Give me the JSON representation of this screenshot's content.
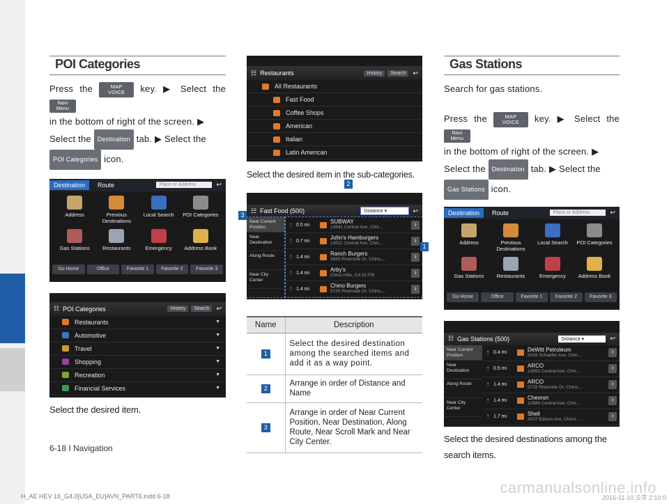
{
  "left": {
    "title": "POI Categories",
    "s1a": "Press the",
    "key_map": "MAP",
    "key_voice": "VOICE",
    "s1b": "key. ▶ Select the",
    "key_navi": "Navi",
    "key_menu": "Menu",
    "s2": "in the bottom of right of the screen. ▶",
    "s3a": "Select the",
    "pill_dest": "Destination",
    "s3b": "tab. ▶ Select the",
    "pill_poi": "POI Categories",
    "s4": "icon.",
    "caption": "Select the desired item.",
    "shot1": {
      "tab_dest": "Destination",
      "tab_route": "Route",
      "search_placeholder": "Place or Address",
      "tiles": [
        "Address",
        "Previous Destinations",
        "Local Search",
        "POI Categories",
        "Gas Stations",
        "Restaurants",
        "Emergency",
        "Address Book"
      ],
      "favs": [
        "Go Home",
        "Office",
        "Favorite 1",
        "Favorite 2",
        "Favorite 3"
      ]
    },
    "shot2": {
      "title": "POI Categories",
      "btn_history": "History",
      "btn_search": "Search",
      "items": [
        "Restaurants",
        "Automotive",
        "Travel",
        "Shopping",
        "Recreation",
        "Financial Services"
      ],
      "colors": [
        "#e07a2b",
        "#3a78c2",
        "#c89b3a",
        "#9a3fa0",
        "#7da23a",
        "#3f9a4a"
      ]
    }
  },
  "middle": {
    "shot3": {
      "title": "Restaurants",
      "btn_history": "History",
      "btn_search": "Search",
      "items": [
        "All Restaurants",
        "Fast Food",
        "Coffee Shops",
        "American",
        "Italian",
        "Latin American"
      ]
    },
    "caption": "Select the desired item in the sub-categories.",
    "shot4": {
      "title": "Fast Food (500)",
      "sort": "Distance",
      "side": [
        "Near Current Position",
        "Near Destination",
        "Along Route",
        "Near City Center"
      ],
      "rows": [
        {
          "dist": "0.5 mi",
          "name": "SUBWAY",
          "addr": "13641 Central Ave, Chin..."
        },
        {
          "dist": "0.7 mi",
          "name": "John's Hamburgers",
          "addr": "13511 Central Ave, Chin..."
        },
        {
          "dist": "1.4 mi",
          "name": "Ranch Burgers",
          "addr": "5685 Riverside Dr, Chino,..."
        },
        {
          "dist": "1.4 mi",
          "name": "Arby's",
          "addr": "Chino Hills, CA 91709"
        },
        {
          "dist": "1.4 mi",
          "name": "Chino Burgers",
          "addr": "5725 Riverside Dr, Chino,..."
        }
      ]
    },
    "markers": [
      "1",
      "2",
      "3"
    ],
    "table": {
      "col_name": "Name",
      "col_desc": "Description",
      "rows": [
        {
          "num": "1",
          "desc": "Select the desired destination among the searched items and add it as a way point."
        },
        {
          "num": "2",
          "desc": "Arrange in order of Distance and Name"
        },
        {
          "num": "3",
          "desc": "Arrange in order of Near Current Position, Near Destination, Along Route, Near Scroll Mark and Near City Center."
        }
      ]
    }
  },
  "right": {
    "title": "Gas Stations",
    "intro": "Search for gas stations.",
    "s1a": "Press the",
    "s1b": "key. ▶ Select the",
    "s2": "in the bottom of right of the screen. ▶",
    "s3a": "Select the",
    "pill_dest": "Destination",
    "s3b": "tab. ▶ Select the",
    "pill_gas": "Gas Stations",
    "s4": "icon.",
    "shot6": {
      "title": "Gas Stations (500)",
      "sort": "Distance",
      "rows": [
        {
          "dist": "0.4 mi",
          "name": "DeWitt Petroleum",
          "addr": "5415 Schaefer Ave, Chin..."
        },
        {
          "dist": "0.5 mi",
          "name": "ARCO",
          "addr": "13691 Central Ave, Chin..."
        },
        {
          "dist": "1.4 mi",
          "name": "ARCO",
          "addr": "5715 Riverside Dr, Chino,..."
        },
        {
          "dist": "1.4 mi",
          "name": "Chevron",
          "addr": "12886 Central Ave, Chin..."
        },
        {
          "dist": "1.7 mi",
          "name": "Shell",
          "addr": "4107 Edison Ave, Chino, ..."
        }
      ]
    },
    "caption": "Select the desired destinations among the search items."
  },
  "footer": {
    "page": "6-18 I Navigation",
    "file": "H_AE HEV 16_G4.0[USA_EU]AVN_PART6.indd   6-18",
    "date": "2016-11-10   오후 2:10:0",
    "watermark": "carmanualsonline.info"
  }
}
